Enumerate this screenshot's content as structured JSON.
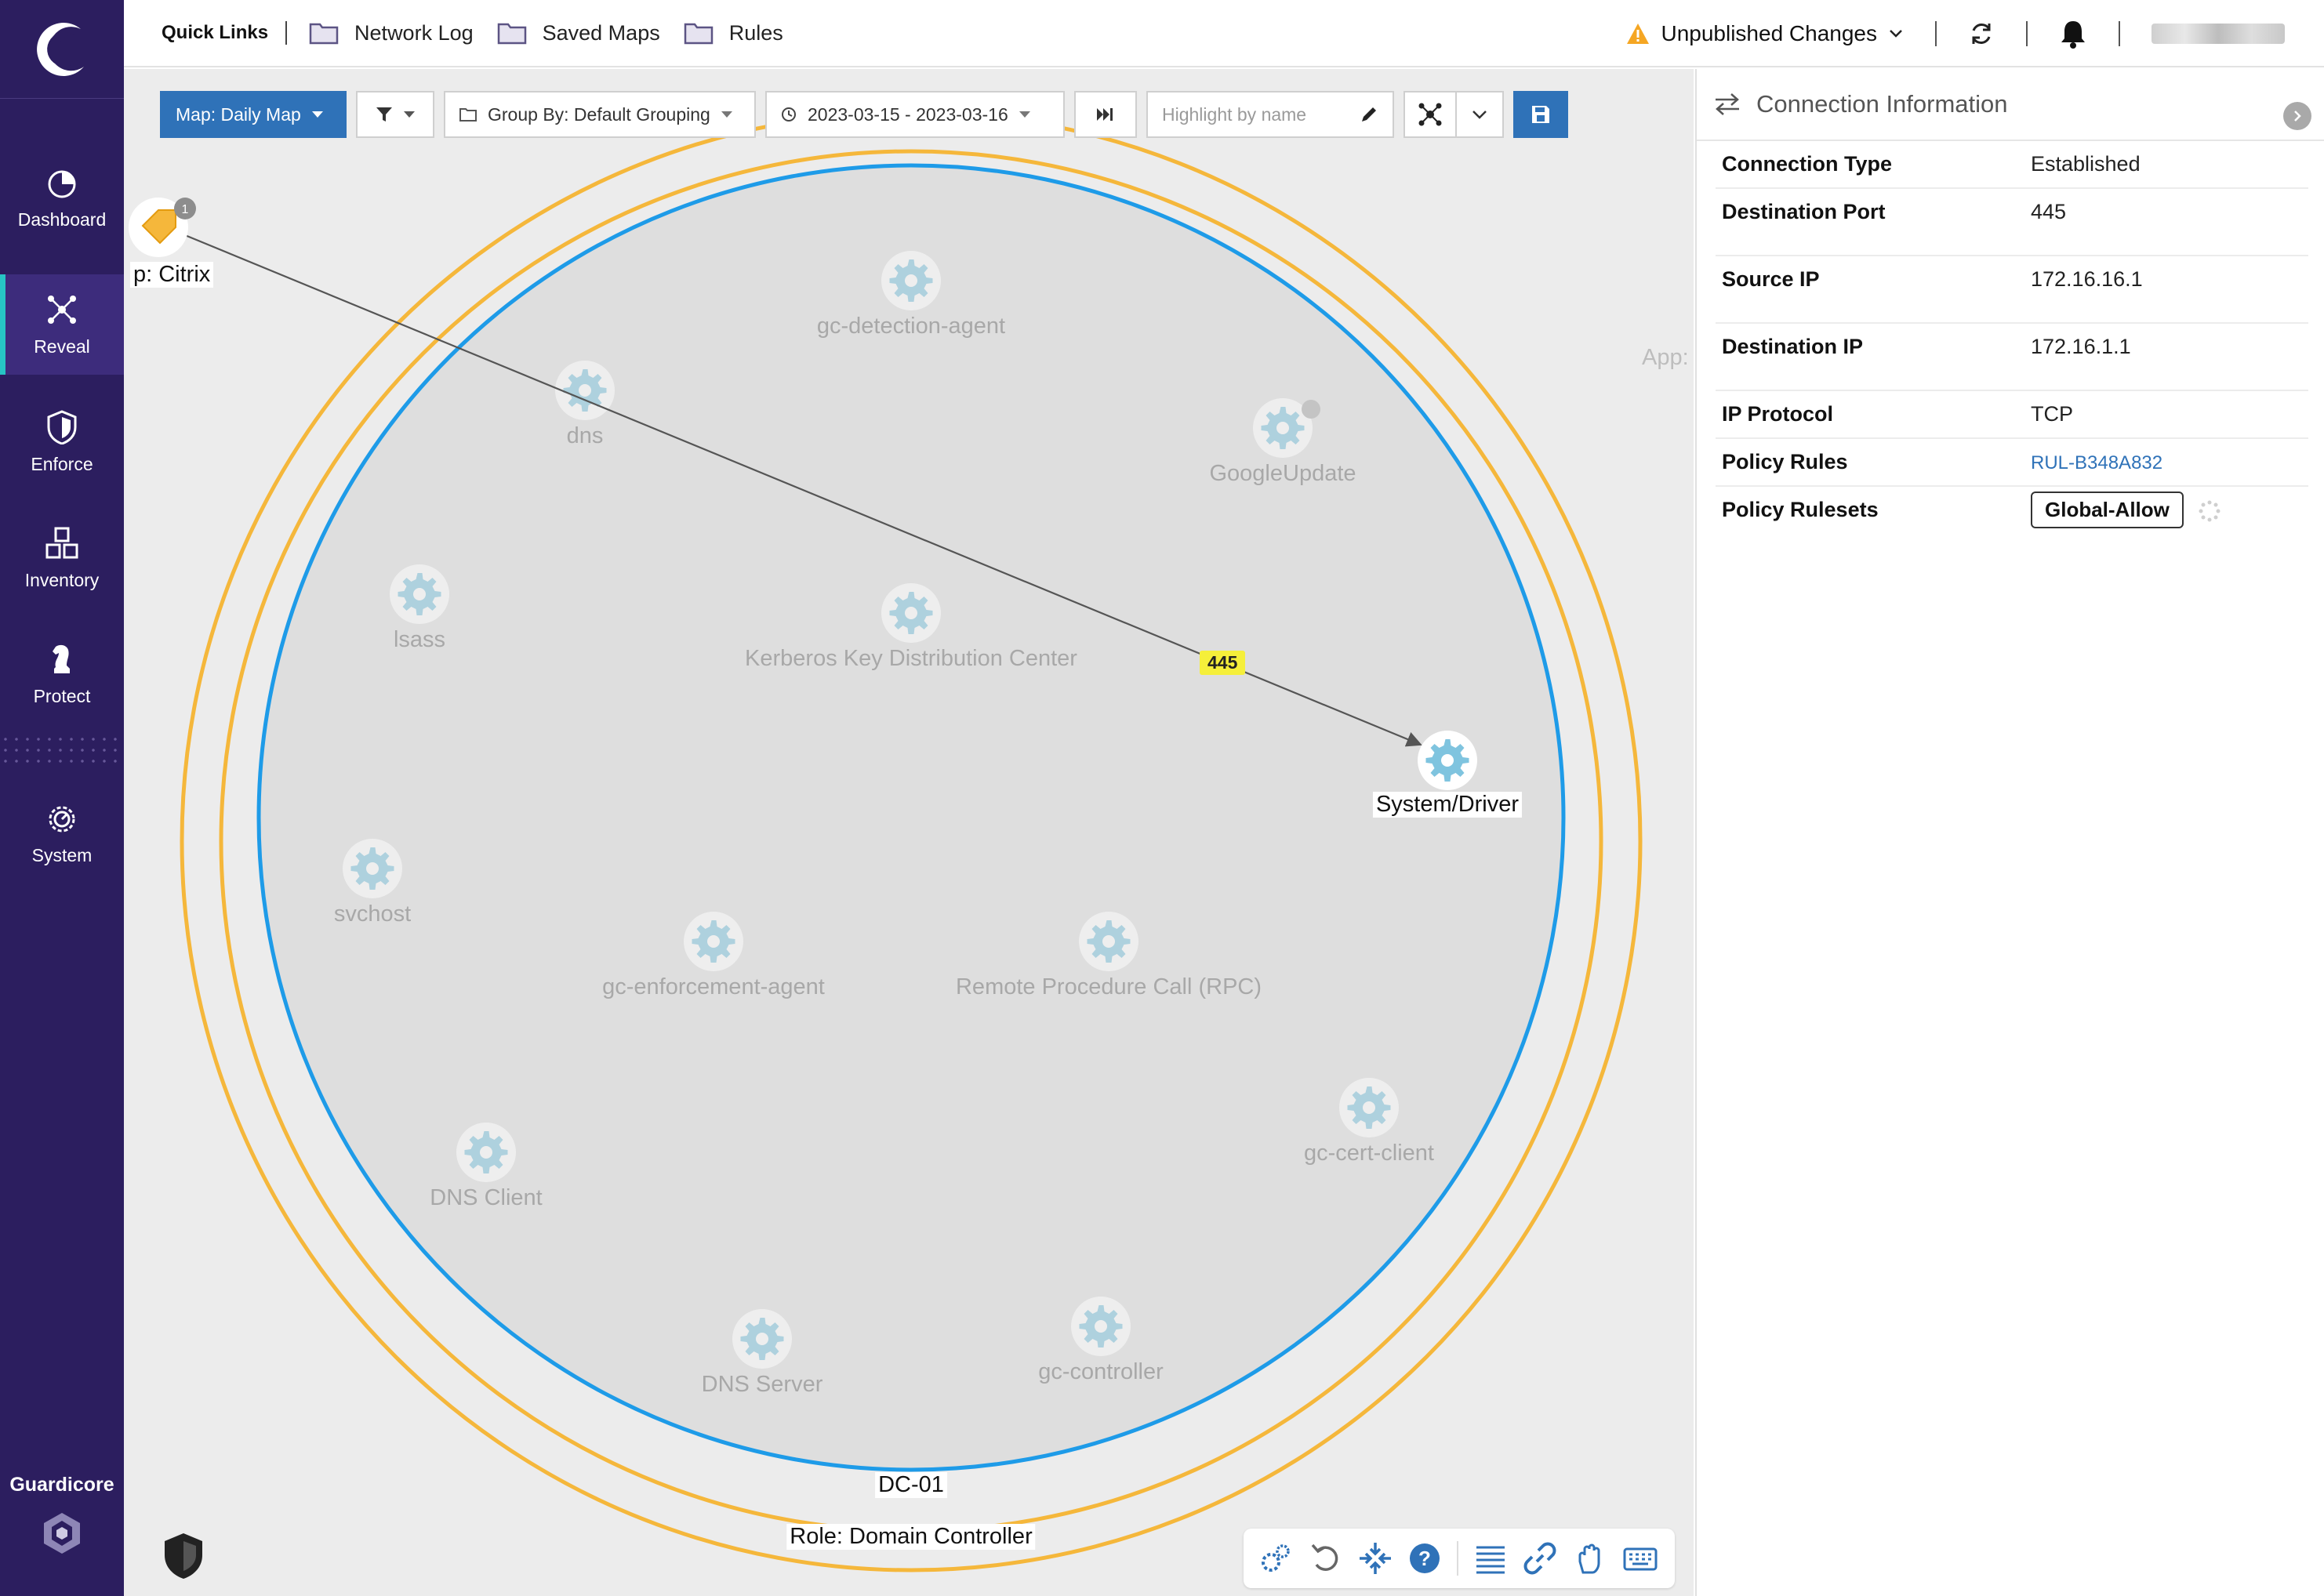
{
  "sidebar": {
    "items": [
      {
        "label": "Dashboard",
        "icon": "pie-chart-icon"
      },
      {
        "label": "Reveal",
        "icon": "network-icon",
        "active": true
      },
      {
        "label": "Enforce",
        "icon": "shield-icon"
      },
      {
        "label": "Inventory",
        "icon": "cubes-icon"
      },
      {
        "label": "Protect",
        "icon": "chess-knight-icon"
      },
      {
        "label": "System",
        "icon": "gear-icon"
      }
    ],
    "brand": "Guardicore"
  },
  "topbar": {
    "quick_links_label": "Quick Links",
    "links": [
      "Network Log",
      "Saved Maps",
      "Rules"
    ],
    "unpublished_label": "Unpublished Changes"
  },
  "toolbar": {
    "map_label": "Map: Daily Map",
    "group_by_label": "Group By: Default Grouping",
    "date_range": "2023-03-15 - 2023-03-16",
    "highlight_placeholder": "Highlight by name"
  },
  "map": {
    "source_label": "p: Citrix",
    "source_badge": "1",
    "app_stub": "App:",
    "port": "445",
    "target_label": "System/Driver",
    "cluster_label": "DC-01",
    "role_label": "Role: Domain Controller",
    "nodes": {
      "gc_detection_agent": "gc-detection-agent",
      "dns": "dns",
      "googleupdate": "GoogleUpdate",
      "lsass": "lsass",
      "kerberos": "Kerberos Key Distribution Center",
      "svchost": "svchost",
      "gc_enforcement_agent": "gc-enforcement-agent",
      "rpc": "Remote Procedure Call (RPC)",
      "gc_cert_client": "gc-cert-client",
      "dns_client": "DNS Client",
      "dns_server": "DNS Server",
      "gc_controller": "gc-controller"
    }
  },
  "panel": {
    "title": "Connection Information",
    "rows": {
      "connection_type": {
        "k": "Connection Type",
        "v": "Established"
      },
      "destination_port": {
        "k": "Destination Port",
        "v": "445"
      },
      "source_ip": {
        "k": "Source IP",
        "v": "172.16.16.1"
      },
      "destination_ip": {
        "k": "Destination IP",
        "v": "172.16.1.1"
      },
      "ip_protocol": {
        "k": "IP Protocol",
        "v": "TCP"
      },
      "policy_rules": {
        "k": "Policy Rules",
        "v": "RUL-B348A832"
      },
      "policy_rulesets": {
        "k": "Policy Rulesets",
        "v": "Global-Allow"
      }
    }
  },
  "colors": {
    "sidebar_bg": "#2c1e5f",
    "accent_blue": "#2f72b8",
    "ring_orange": "#f5b73b",
    "ring_blue": "#1e9be8",
    "node_gear": "#7fc4df"
  }
}
